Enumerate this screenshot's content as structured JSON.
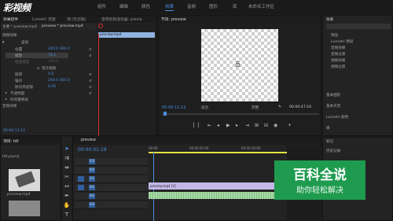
{
  "watermark_logo": "彩视频",
  "topbar": {
    "menus": [
      "组件",
      "编辑",
      "颜色",
      "效果",
      "音频",
      "图形",
      "库",
      "未命名工作区"
    ],
    "active_index": 3
  },
  "effect_controls": {
    "tabs": [
      "效果控件",
      "Lumetri 范围",
      "源:(无剪辑)",
      "音频剪辑混合器: previe"
    ],
    "master_label": "主要 * preview.mp4",
    "sequence_label": "preview * preview.mp4",
    "section_video": "视频效果",
    "motion": "运动",
    "position_label": "位置",
    "position_value": "240.0   360.0",
    "scale_label": "缩放",
    "scale_value": "72.1",
    "scale_width_label": "缩放宽度",
    "scale_width_value": "100.0",
    "uniform_scale": "等比缩放",
    "rotation_label": "旋转",
    "rotation_value": "0.0",
    "anchor_label": "锚点",
    "anchor_value": "240.0   360.0",
    "flicker_label": "防闪烁滤镜",
    "flicker_value": "0.00",
    "opacity_label": "不透明度",
    "timeremap_label": "时间重映射",
    "section_audio": "音频效果",
    "mini_clip": "preview.mp4",
    "timecode": "00:00:11:12"
  },
  "program_monitor": {
    "title": "节目: preview",
    "timecode_left": "00:00:11:12",
    "fit_label": "适合",
    "quality_label": "完整",
    "timecode_right": "00:00:47:16",
    "center_glyph": "亘"
  },
  "effects_panel": {
    "title": "效果",
    "items": [
      "预设",
      "Lumetri 预设",
      "音频效果",
      "音频过渡",
      "视频效果",
      "视频过渡"
    ],
    "sections": [
      "基本图形",
      "基本声音",
      "Lumetri 颜色",
      "库",
      "标记",
      "历史记录"
    ]
  },
  "project_panel": {
    "title": "项目: tdt",
    "file": "tdt.prproj",
    "thumb1_label": "preview.mp4",
    "thumb2_label": "preview"
  },
  "timeline": {
    "title": "preview",
    "timecode": "00:00:01:19",
    "ruler_marks": [
      "00:00",
      "00:00:05:00",
      "00:00:10:00",
      "00:00:15:00"
    ],
    "tracks": [
      "V3",
      "V2",
      "V1",
      "A1",
      "A2",
      "A3"
    ],
    "video_clip": "preview.mp4 [V]"
  },
  "badge": {
    "main": "百科全说",
    "sub": "助你轻松解决"
  },
  "colors": {
    "accent": "#4a8fe0",
    "badge_bg": "#1e9b4e"
  }
}
